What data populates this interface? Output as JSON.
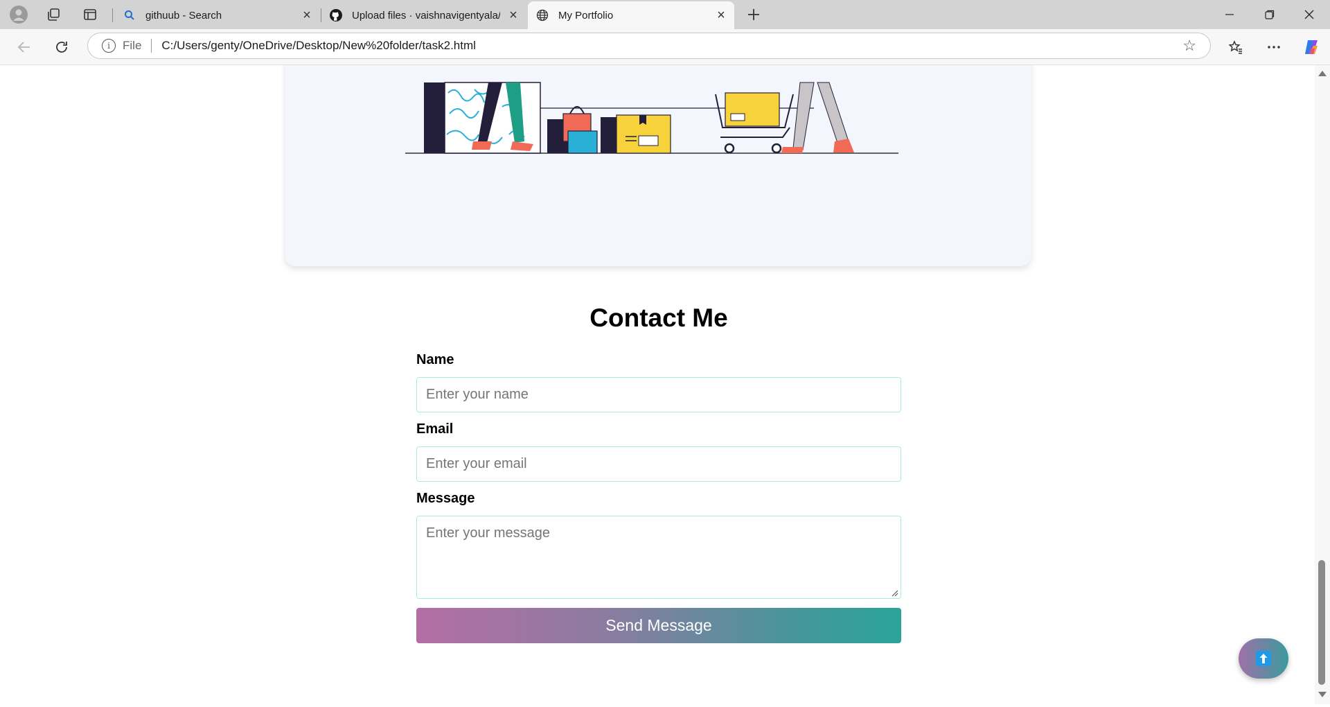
{
  "browser": {
    "tabs": [
      {
        "label": "githuub - Search",
        "icon": "search-icon"
      },
      {
        "label": "Upload files · vaishnavigentyala/W",
        "icon": "github-icon"
      },
      {
        "label": "My Portfolio",
        "icon": "globe-icon",
        "active": true
      }
    ],
    "address": {
      "scheme": "File",
      "url": "C:/Users/genty/OneDrive/Desktop/New%20folder/task2.html"
    }
  },
  "contact": {
    "title": "Contact Me",
    "name_label": "Name",
    "name_placeholder": "Enter your name",
    "email_label": "Email",
    "email_placeholder": "Enter your email",
    "message_label": "Message",
    "message_placeholder": "Enter your message",
    "submit_label": "Send Message"
  },
  "colors": {
    "input_border": "#a8f0c8",
    "button_gradient_start": "#b56ea5",
    "button_gradient_end": "#2aa39b",
    "card_background": "#f4f6fe"
  },
  "icons": {
    "scroll_to_top": "arrow-up-icon"
  }
}
